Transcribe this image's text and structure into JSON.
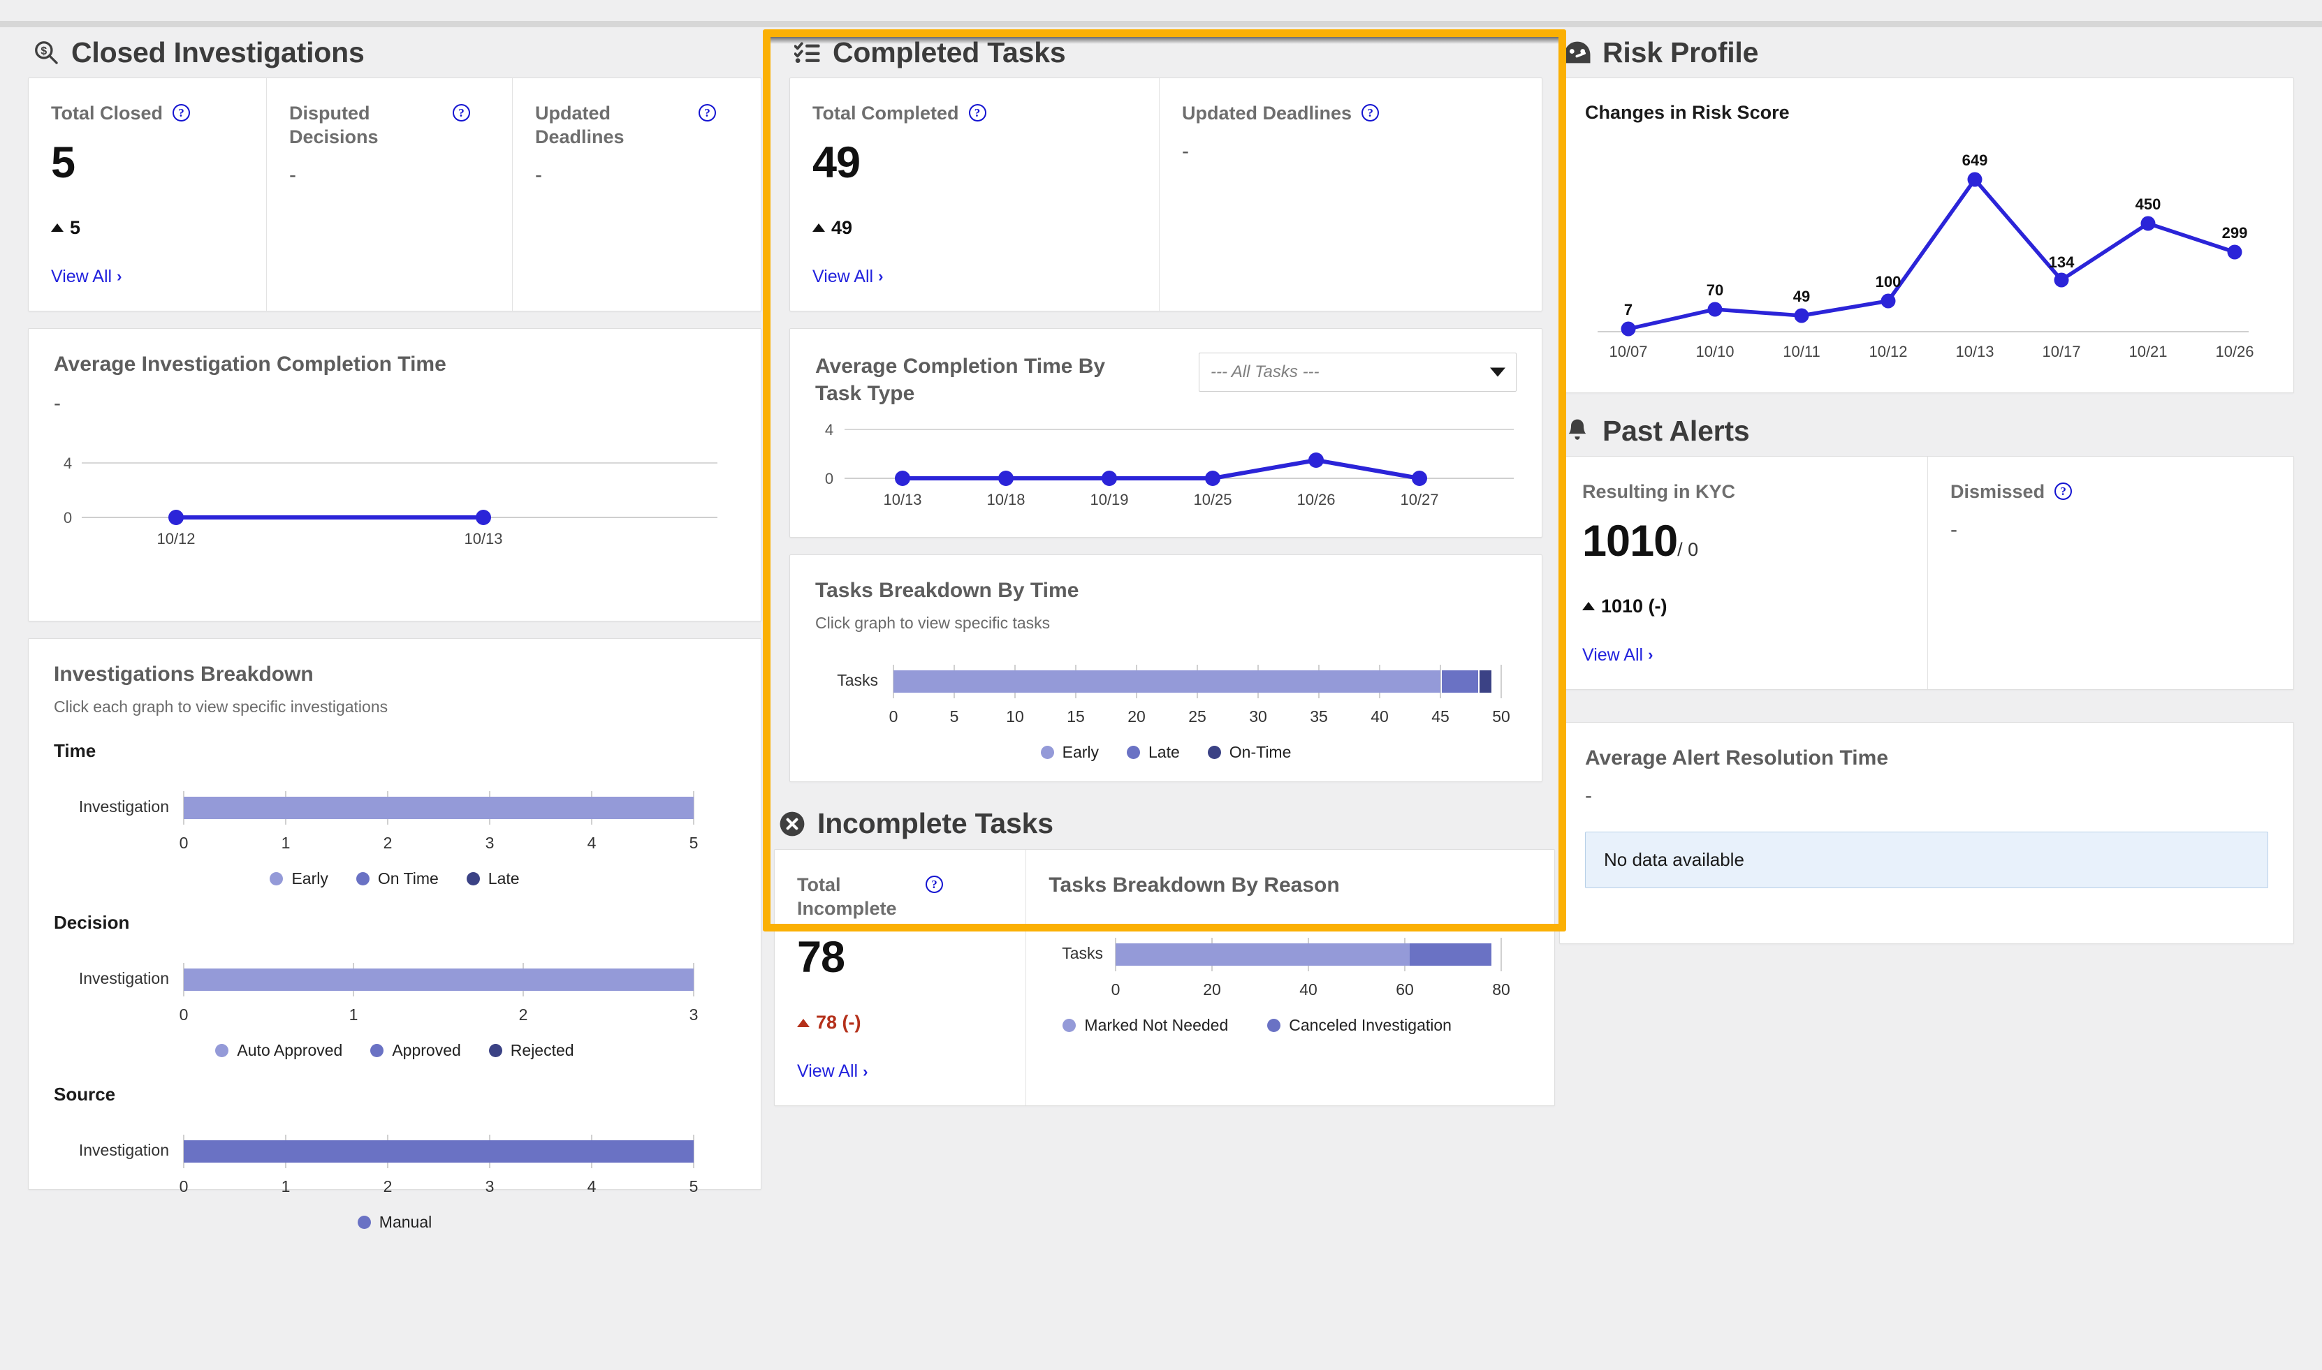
{
  "colors": {
    "highlight": "#fbb004",
    "line_blue": "#2b24d8",
    "purple_light": "#949ad8",
    "purple_mid": "#6a72c4",
    "purple_dark": "#3b4285",
    "link": "#2222dd",
    "negative": "#b4301a"
  },
  "closed_investigations": {
    "section_title": "Closed Investigations",
    "section_icon": "search-dollar-icon",
    "stats": [
      {
        "label": "Total Closed",
        "help": "?",
        "value": "5",
        "delta": "5",
        "view_all": "View All",
        "chevron": "›"
      },
      {
        "label": "Disputed Decisions",
        "help": "?",
        "value": "-"
      },
      {
        "label": "Updated Deadlines",
        "help": "?",
        "value": "-"
      }
    ],
    "avg_completion": {
      "title": "Average Investigation Completion Time",
      "value": "-"
    },
    "breakdown": {
      "title": "Investigations Breakdown",
      "subtitle": "Click each graph to view specific investigations",
      "groups": [
        {
          "name": "Time",
          "cat_label": "Investigation",
          "legend": [
            "Early",
            "On Time",
            "Late"
          ],
          "ticks": [
            "0",
            "1",
            "2",
            "3",
            "4",
            "5"
          ]
        },
        {
          "name": "Decision",
          "cat_label": "Investigation",
          "legend": [
            "Auto Approved",
            "Approved",
            "Rejected"
          ],
          "ticks": [
            "0",
            "1",
            "2",
            "3"
          ]
        },
        {
          "name": "Source",
          "cat_label": "Investigation",
          "legend": [
            "Manual"
          ],
          "ticks": [
            "0",
            "1",
            "2",
            "3",
            "4",
            "5"
          ]
        }
      ]
    }
  },
  "completed_tasks": {
    "section_title": "Completed Tasks",
    "section_icon": "checklist-icon",
    "highlighted": true,
    "stats": [
      {
        "label": "Total Completed",
        "help": "?",
        "value": "49",
        "delta": "49",
        "view_all": "View All",
        "chevron": "›"
      },
      {
        "label": "Updated Deadlines",
        "help": "?",
        "value": "-"
      }
    ],
    "avg_by_type": {
      "title": "Average Completion Time By Task Type",
      "filter_value": "--- All Tasks ---",
      "filter_options": [
        "--- All Tasks ---"
      ]
    },
    "breakdown_by_time": {
      "title": "Tasks Breakdown By Time",
      "subtitle": "Click graph to view specific tasks",
      "cat_label": "Tasks",
      "legend": [
        "Early",
        "Late",
        "On-Time"
      ],
      "ticks": [
        "0",
        "5",
        "10",
        "15",
        "20",
        "25",
        "30",
        "35",
        "40",
        "45",
        "50"
      ]
    }
  },
  "incomplete_tasks": {
    "section_title": "Incomplete Tasks",
    "section_icon": "circle-x-icon",
    "stats": [
      {
        "label": "Total Incomplete",
        "help": "?",
        "value": "78",
        "delta": "78 (-)",
        "view_all": "View All",
        "chevron": "›"
      }
    ],
    "breakdown_by_reason": {
      "title": "Tasks Breakdown By Reason",
      "cat_label": "Tasks",
      "legend": [
        "Marked Not Needed",
        "Canceled Investigation"
      ],
      "ticks": [
        "0",
        "20",
        "40",
        "60",
        "80"
      ]
    }
  },
  "risk_profile": {
    "section_title": "Risk Profile",
    "section_icon": "gauge-icon",
    "chart_title": "Changes in Risk Score"
  },
  "past_alerts": {
    "section_title": "Past Alerts",
    "section_icon": "bell-icon",
    "stats": [
      {
        "label": "Resulting in KYC",
        "value": "1010",
        "value_sub": "/ 0",
        "delta": "1010 (-)",
        "view_all": "View All",
        "chevron": "›"
      },
      {
        "label": "Dismissed",
        "help": "?",
        "value": "-"
      }
    ],
    "avg_alert_resolution": {
      "title": "Average Alert Resolution Time",
      "value": "-",
      "empty_message": "No data available"
    }
  },
  "chart_data": [
    {
      "id": "avg_investigation_completion_time",
      "type": "line",
      "title": "Average Investigation Completion Time",
      "x": [
        "10/12",
        "10/13"
      ],
      "values": [
        0,
        0
      ],
      "ylabel": "",
      "yticks": [
        0,
        4
      ],
      "ylim": [
        0,
        4
      ],
      "grid": true
    },
    {
      "id": "investigations_breakdown_time",
      "type": "bar",
      "orientation": "horizontal",
      "stacked": true,
      "title": "Time",
      "categories": [
        "Investigation"
      ],
      "series": [
        {
          "name": "Early",
          "values": [
            5
          ],
          "color": "#949ad8"
        },
        {
          "name": "On Time",
          "values": [
            0
          ],
          "color": "#6a72c4"
        },
        {
          "name": "Late",
          "values": [
            0
          ],
          "color": "#3b4285"
        }
      ],
      "xlim": [
        0,
        5
      ],
      "xticks": [
        0,
        1,
        2,
        3,
        4,
        5
      ]
    },
    {
      "id": "investigations_breakdown_decision",
      "type": "bar",
      "orientation": "horizontal",
      "stacked": true,
      "title": "Decision",
      "categories": [
        "Investigation"
      ],
      "series": [
        {
          "name": "Auto Approved",
          "values": [
            3
          ],
          "color": "#949ad8"
        },
        {
          "name": "Approved",
          "values": [
            0
          ],
          "color": "#6a72c4"
        },
        {
          "name": "Rejected",
          "values": [
            0
          ],
          "color": "#3b4285"
        }
      ],
      "xlim": [
        0,
        3
      ],
      "xticks": [
        0,
        1,
        2,
        3
      ]
    },
    {
      "id": "investigations_breakdown_source",
      "type": "bar",
      "orientation": "horizontal",
      "stacked": true,
      "title": "Source",
      "categories": [
        "Investigation"
      ],
      "series": [
        {
          "name": "Manual",
          "values": [
            5
          ],
          "color": "#6a72c4"
        }
      ],
      "xlim": [
        0,
        5
      ],
      "xticks": [
        0,
        1,
        2,
        3,
        4,
        5
      ]
    },
    {
      "id": "avg_completion_time_by_task_type",
      "type": "line",
      "title": "Average Completion Time By Task Type",
      "x": [
        "10/13",
        "10/18",
        "10/19",
        "10/25",
        "10/26",
        "10/27"
      ],
      "values": [
        0,
        0,
        0,
        0,
        1.1,
        0
      ],
      "yticks": [
        0,
        4
      ],
      "ylim": [
        0,
        4
      ],
      "grid": true
    },
    {
      "id": "tasks_breakdown_by_time",
      "type": "bar",
      "orientation": "horizontal",
      "stacked": true,
      "title": "Tasks Breakdown By Time",
      "categories": [
        "Tasks"
      ],
      "series": [
        {
          "name": "Early",
          "values": [
            45
          ],
          "color": "#949ad8"
        },
        {
          "name": "Late",
          "values": [
            3
          ],
          "color": "#6a72c4"
        },
        {
          "name": "On-Time",
          "values": [
            1
          ],
          "color": "#3b4285"
        }
      ],
      "xlim": [
        0,
        50
      ],
      "xticks": [
        0,
        5,
        10,
        15,
        20,
        25,
        30,
        35,
        40,
        45,
        50
      ]
    },
    {
      "id": "tasks_breakdown_by_reason",
      "type": "bar",
      "orientation": "horizontal",
      "stacked": true,
      "title": "Tasks Breakdown By Reason",
      "categories": [
        "Tasks"
      ],
      "series": [
        {
          "name": "Marked Not Needed",
          "values": [
            61
          ],
          "color": "#949ad8"
        },
        {
          "name": "Canceled Investigation",
          "values": [
            17
          ],
          "color": "#6a72c4"
        }
      ],
      "xlim": [
        0,
        80
      ],
      "xticks": [
        0,
        20,
        40,
        60,
        80
      ]
    },
    {
      "id": "changes_in_risk_score",
      "type": "line",
      "title": "Changes in Risk Score",
      "x": [
        "10/07",
        "10/10",
        "10/11",
        "10/12",
        "10/13",
        "10/17",
        "10/21",
        "10/26"
      ],
      "values": [
        7,
        70,
        49,
        100,
        649,
        134,
        450,
        299
      ],
      "labels": [
        "7",
        "70",
        "49",
        "100",
        "649",
        "134",
        "450",
        "299"
      ],
      "ylim": [
        0,
        700
      ],
      "grid": false
    }
  ]
}
